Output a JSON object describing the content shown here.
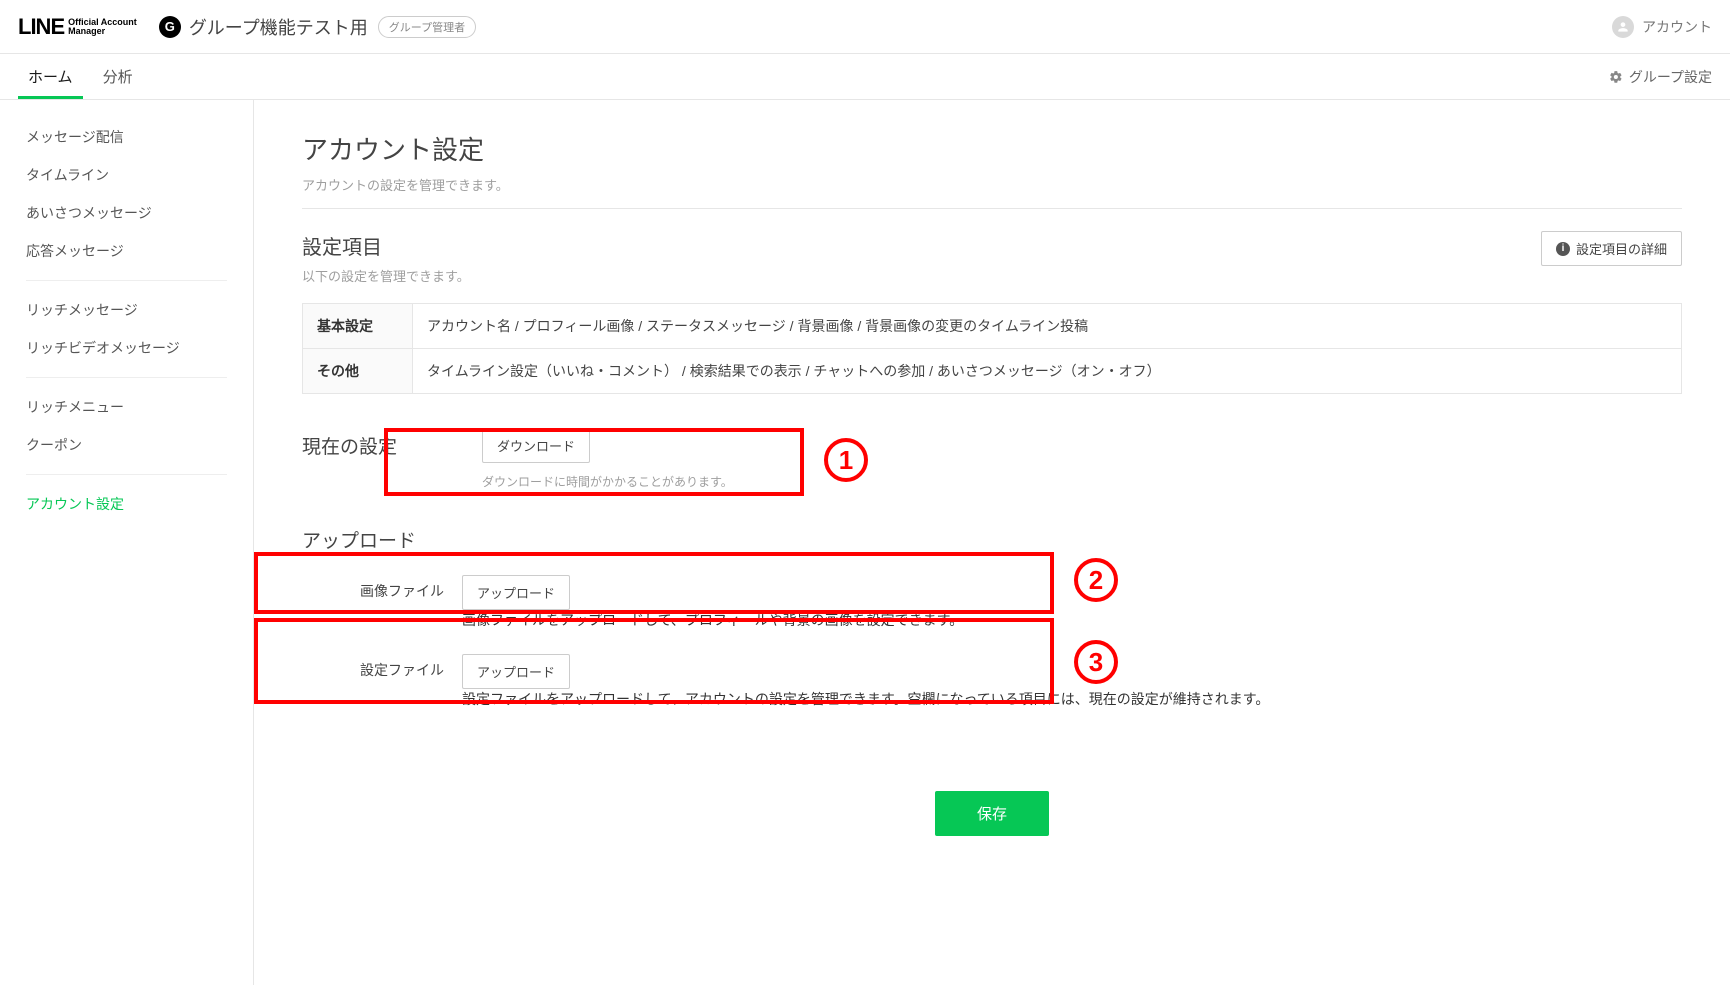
{
  "topbar": {
    "brand_main": "LINE",
    "brand_sub1": "Official Account",
    "brand_sub2": "Manager",
    "group_badge": "G",
    "group_title": "グループ機能テスト用",
    "group_role": "グループ管理者",
    "account_label": "アカウント"
  },
  "tabs": {
    "home": "ホーム",
    "analytics": "分析",
    "group_settings": "グループ設定"
  },
  "sidebar": {
    "g1": [
      "メッセージ配信",
      "タイムライン",
      "あいさつメッセージ",
      "応答メッセージ"
    ],
    "g2": [
      "リッチメッセージ",
      "リッチビデオメッセージ"
    ],
    "g3": [
      "リッチメニュー",
      "クーポン"
    ],
    "g4": [
      "アカウント設定"
    ]
  },
  "page": {
    "title": "アカウント設定",
    "subtitle": "アカウントの設定を管理できます。"
  },
  "settings_items": {
    "title": "設定項目",
    "subtitle": "以下の設定を管理できます。",
    "detail_button": "設定項目の詳細",
    "rows": [
      {
        "th": "基本設定",
        "td": "アカウント名 / プロフィール画像 / ステータスメッセージ / 背景画像 / 背景画像の変更のタイムライン投稿"
      },
      {
        "th": "その他",
        "td": "タイムライン設定（いいね・コメント） / 検索結果での表示 / チャットへの参加 / あいさつメッセージ（オン・オフ）"
      }
    ]
  },
  "current": {
    "label": "現在の設定",
    "download_button": "ダウンロード",
    "hint": "ダウンロードに時間がかかることがあります。"
  },
  "upload": {
    "title": "アップロード",
    "image_label": "画像ファイル",
    "image_button": "アップロード",
    "image_hint": "画像ファイルをアップロードして、プロフィールや背景の画像を設定できます。",
    "settings_label": "設定ファイル",
    "settings_button": "アップロード",
    "settings_hint": "設定ファイルをアップロードして、アカウントの設定を管理できます。空欄になっている項目には、現在の設定が維持されます。"
  },
  "save_button": "保存",
  "annotations": {
    "n1": "1",
    "n2": "2",
    "n3": "3"
  }
}
